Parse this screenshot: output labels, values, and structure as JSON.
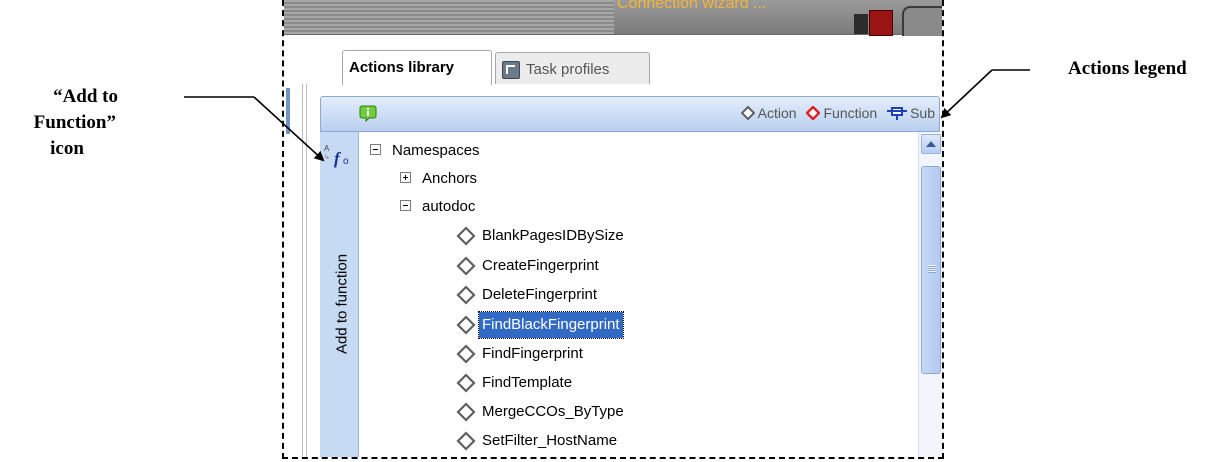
{
  "callouts": {
    "add_to_function": [
      "“Add to",
      "Function”",
      "icon"
    ],
    "actions_legend": "Actions legend"
  },
  "window": {
    "title_fragment": "Connection wizard ..."
  },
  "tabs": [
    {
      "label": "Actions library",
      "active": true
    },
    {
      "label": "Task profiles",
      "active": false
    }
  ],
  "legend": {
    "items": [
      {
        "label": "Action",
        "icon": "diamond-outline-icon",
        "color": "#606060"
      },
      {
        "label": "Function",
        "icon": "diamond-red-icon",
        "color": "#e02020"
      },
      {
        "label": "Sub",
        "icon": "sub-connector-icon",
        "color": "#1f3fbf"
      }
    ]
  },
  "sidebar": {
    "label": "Add to function",
    "icon": "add-to-function-icon"
  },
  "tree": {
    "rows": [
      {
        "label": "Namespaces",
        "toggle": "minus",
        "level": 0
      },
      {
        "label": "Anchors",
        "toggle": "plus",
        "level": 1
      },
      {
        "label": "autodoc",
        "toggle": "minus",
        "level": 1
      },
      {
        "label": "BlankPagesIDBySize",
        "icon": "action-diamond-icon",
        "level": 2
      },
      {
        "label": "CreateFingerprint",
        "icon": "action-diamond-icon",
        "level": 2
      },
      {
        "label": "DeleteFingerprint",
        "icon": "action-diamond-icon",
        "level": 2
      },
      {
        "label": "FindBlackFingerprint",
        "icon": "action-diamond-icon",
        "level": 2,
        "selected": true
      },
      {
        "label": "FindFingerprint",
        "icon": "action-diamond-icon",
        "level": 2
      },
      {
        "label": "FindTemplate",
        "icon": "action-diamond-icon",
        "level": 2
      },
      {
        "label": "MergeCCOs_ByType",
        "icon": "action-diamond-icon",
        "level": 2
      },
      {
        "label": "SetFilter_HostName",
        "icon": "action-diamond-icon",
        "level": 2
      }
    ]
  }
}
